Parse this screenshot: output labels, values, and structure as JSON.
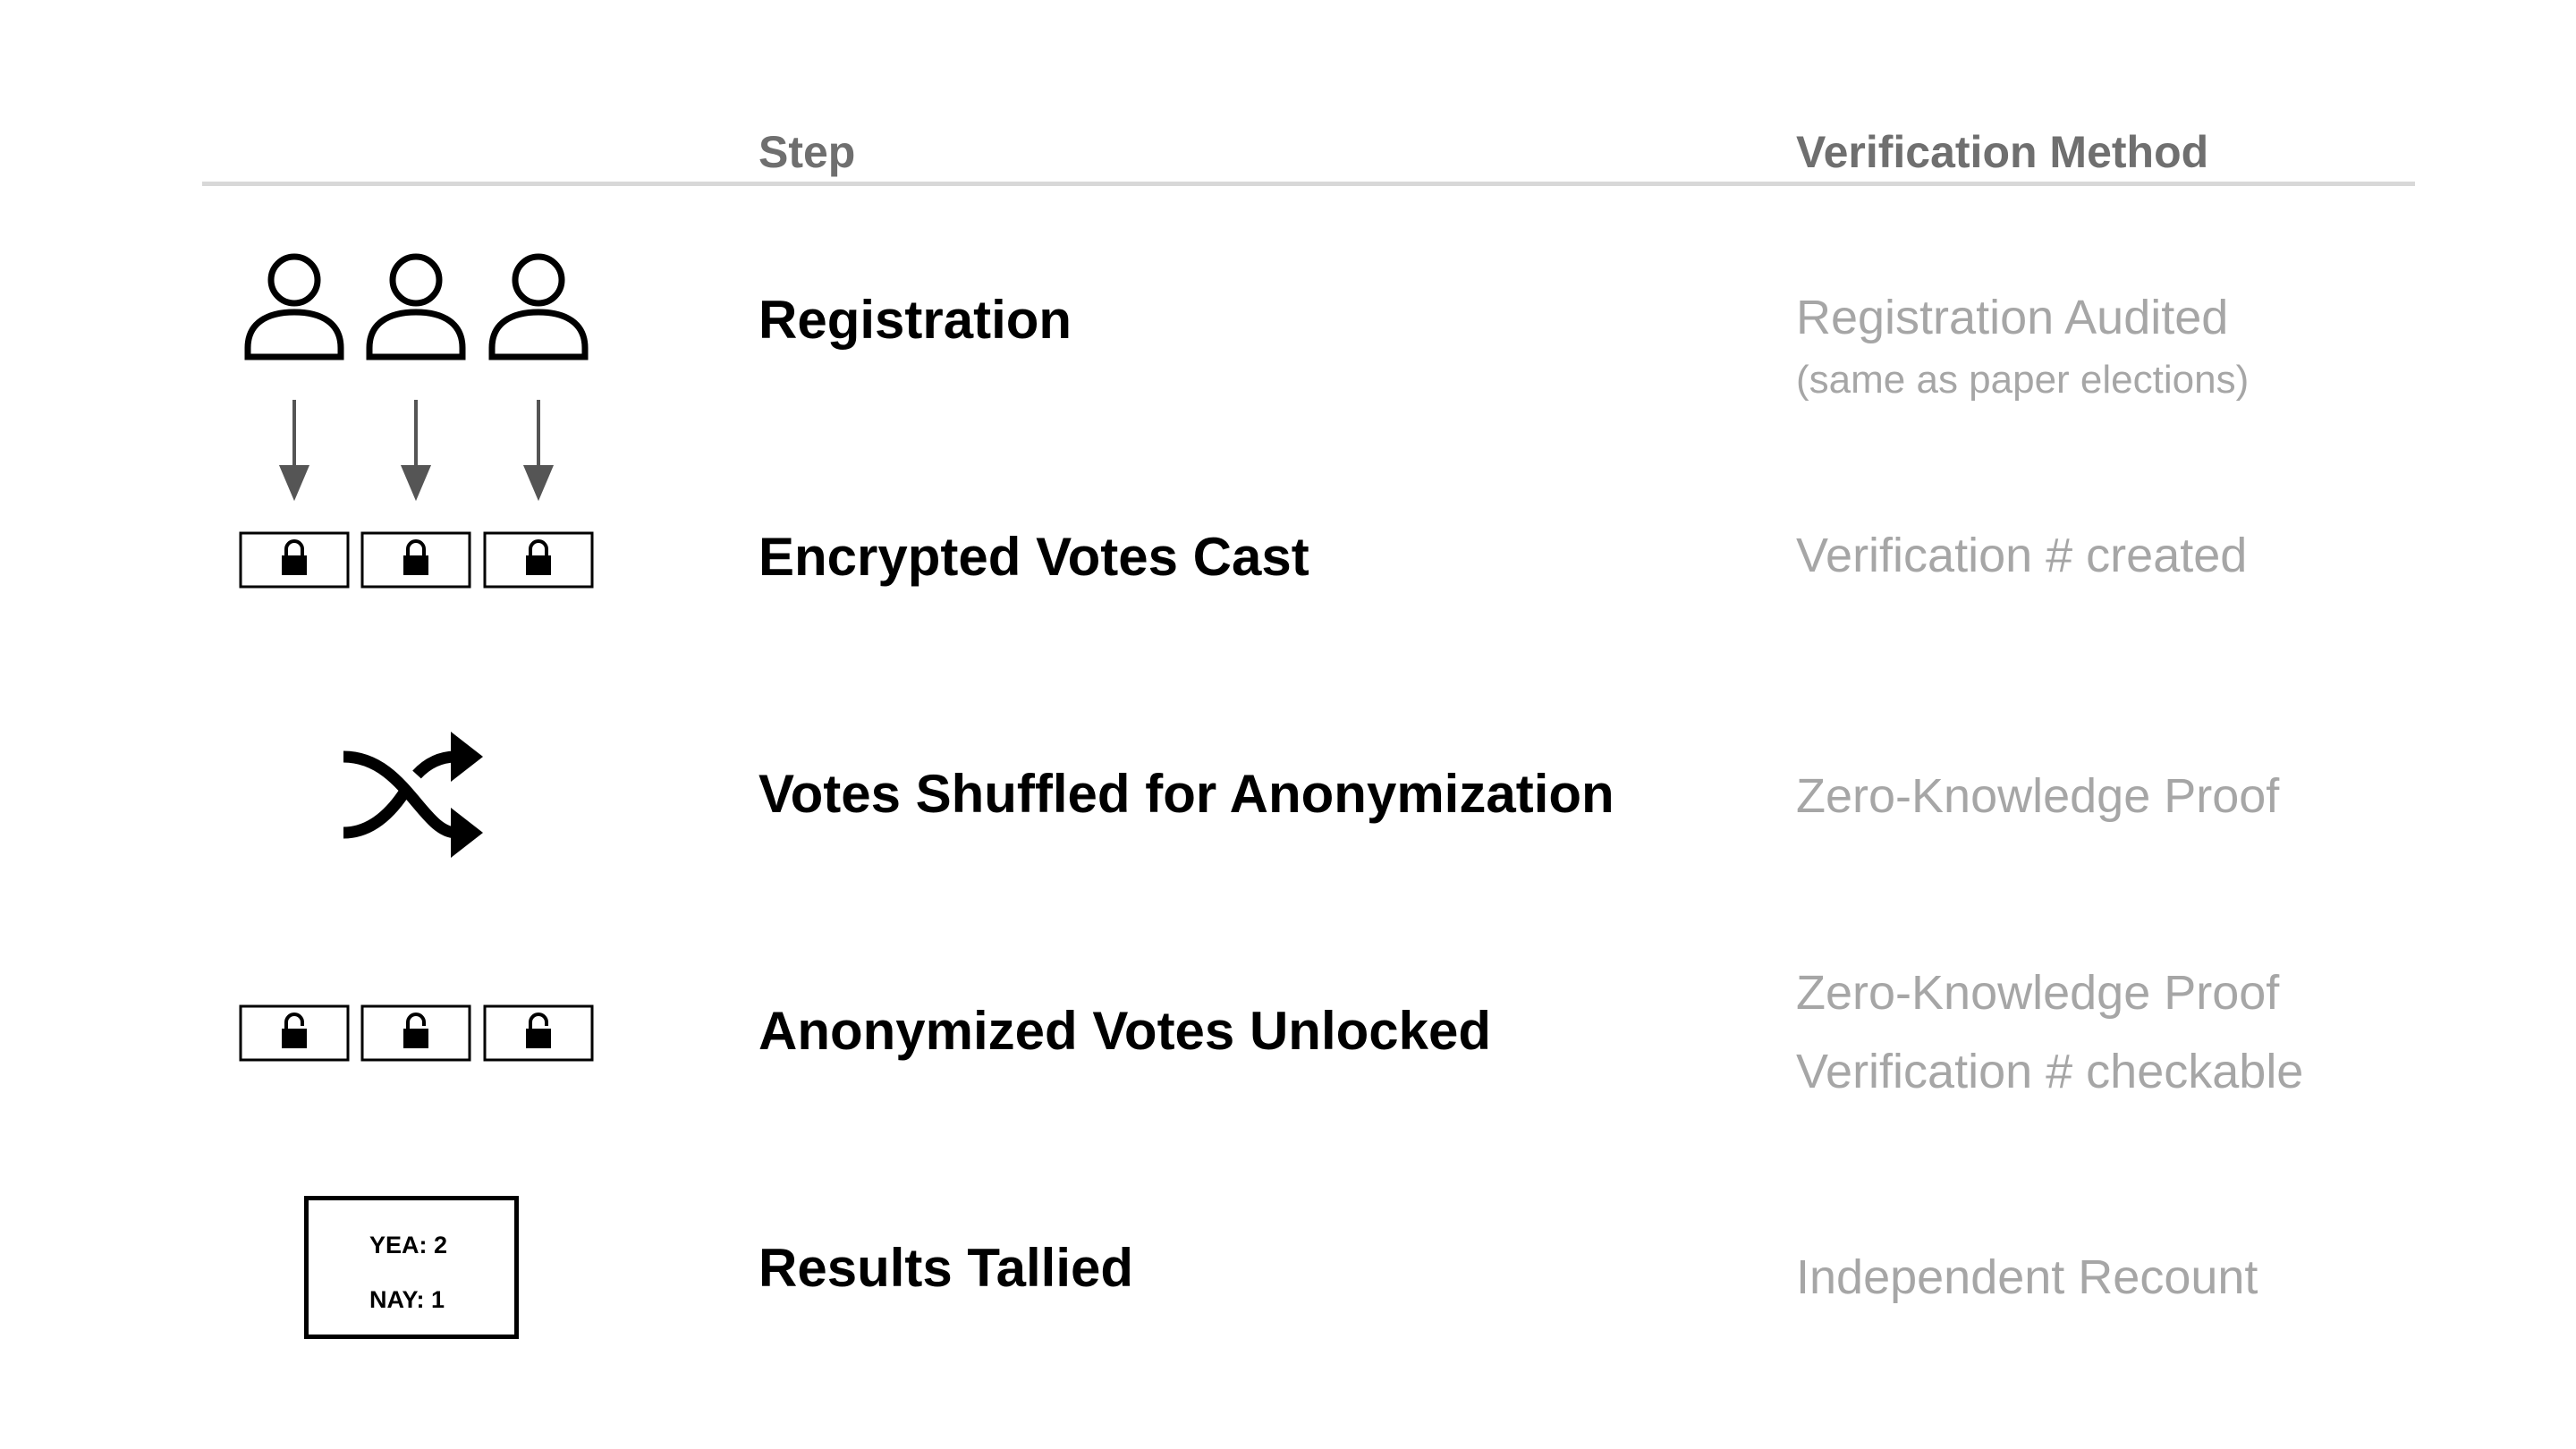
{
  "header": {
    "step_col": "Step",
    "verification_col": "Verification Method"
  },
  "rows": [
    {
      "step": "Registration",
      "verification": [
        "Registration Audited"
      ],
      "verification_note": "(same as paper elections)",
      "icon": "three-person-icons"
    },
    {
      "step": "Encrypted Votes Cast",
      "verification": [
        "Verification # created"
      ],
      "icon": "locked-ballot-boxes"
    },
    {
      "step": "Votes Shuffled for Anonymization",
      "verification": [
        "Zero-Knowledge Proof"
      ],
      "icon": "shuffle-icon"
    },
    {
      "step": "Anonymized Votes Unlocked",
      "verification": [
        "Zero-Knowledge Proof",
        "Verification # checkable"
      ],
      "icon": "unlocked-ballot-boxes"
    },
    {
      "step": "Results Tallied",
      "verification": [
        "Independent Recount"
      ],
      "icon": "tally-box",
      "tally": {
        "yea": "YEA: 2",
        "nay": "NAY: 1"
      }
    }
  ],
  "colors": {
    "header_text": "#6f6f6f",
    "rule": "#d8d8d8",
    "step_text": "#000000",
    "verification_text": "#a6a6a6",
    "arrow": "#555555"
  }
}
